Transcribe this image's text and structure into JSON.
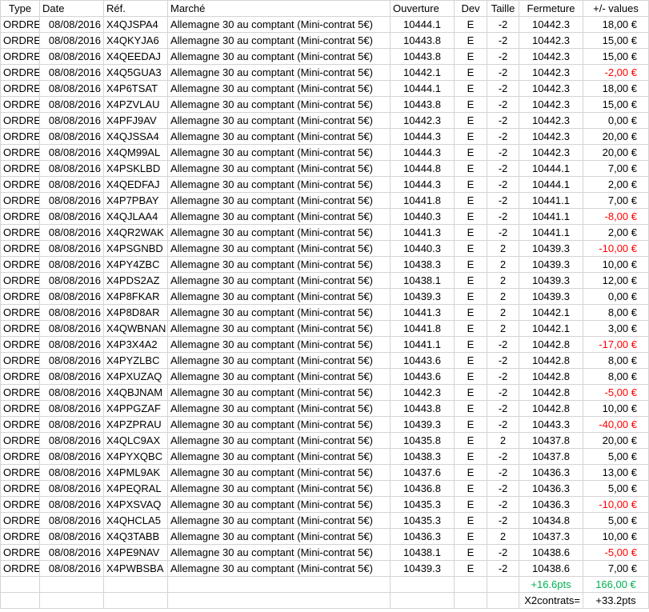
{
  "headers": {
    "type": "Type",
    "date": "Date",
    "ref": "Réf.",
    "market": "Marché",
    "open": "Ouverture",
    "dev": "Dev",
    "size": "Taille",
    "close": "Fermeture",
    "pnl": "+/- values"
  },
  "rows": [
    [
      "ORDRE",
      "08/08/2016",
      "X4QJSPA4",
      "Allemagne 30 au comptant (Mini-contrat 5€)",
      "10444.1",
      "E",
      "-2",
      "10442.3",
      "18,00 €"
    ],
    [
      "ORDRE",
      "08/08/2016",
      "X4QKYJA6",
      "Allemagne 30 au comptant (Mini-contrat 5€)",
      "10443.8",
      "E",
      "-2",
      "10442.3",
      "15,00 €"
    ],
    [
      "ORDRE",
      "08/08/2016",
      "X4QEEDAJ",
      "Allemagne 30 au comptant (Mini-contrat 5€)",
      "10443.8",
      "E",
      "-2",
      "10442.3",
      "15,00 €"
    ],
    [
      "ORDRE",
      "08/08/2016",
      "X4Q5GUA3",
      "Allemagne 30 au comptant (Mini-contrat 5€)",
      "10442.1",
      "E",
      "-2",
      "10442.3",
      "-2,00 €"
    ],
    [
      "ORDRE",
      "08/08/2016",
      "X4P6TSAT",
      "Allemagne 30 au comptant (Mini-contrat 5€)",
      "10444.1",
      "E",
      "-2",
      "10442.3",
      "18,00 €"
    ],
    [
      "ORDRE",
      "08/08/2016",
      "X4PZVLAU",
      "Allemagne 30 au comptant (Mini-contrat 5€)",
      "10443.8",
      "E",
      "-2",
      "10442.3",
      "15,00 €"
    ],
    [
      "ORDRE",
      "08/08/2016",
      "X4PFJ9AV",
      "Allemagne 30 au comptant (Mini-contrat 5€)",
      "10442.3",
      "E",
      "-2",
      "10442.3",
      "0,00 €"
    ],
    [
      "ORDRE",
      "08/08/2016",
      "X4QJSSA4",
      "Allemagne 30 au comptant (Mini-contrat 5€)",
      "10444.3",
      "E",
      "-2",
      "10442.3",
      "20,00 €"
    ],
    [
      "ORDRE",
      "08/08/2016",
      "X4QM99AL",
      "Allemagne 30 au comptant (Mini-contrat 5€)",
      "10444.3",
      "E",
      "-2",
      "10442.3",
      "20,00 €"
    ],
    [
      "ORDRE",
      "08/08/2016",
      "X4PSKLBD",
      "Allemagne 30 au comptant (Mini-contrat 5€)",
      "10444.8",
      "E",
      "-2",
      "10444.1",
      "7,00 €"
    ],
    [
      "ORDRE",
      "08/08/2016",
      "X4QEDFAJ",
      "Allemagne 30 au comptant (Mini-contrat 5€)",
      "10444.3",
      "E",
      "-2",
      "10444.1",
      "2,00 €"
    ],
    [
      "ORDRE",
      "08/08/2016",
      "X4P7PBAY",
      "Allemagne 30 au comptant (Mini-contrat 5€)",
      "10441.8",
      "E",
      "-2",
      "10441.1",
      "7,00 €"
    ],
    [
      "ORDRE",
      "08/08/2016",
      "X4QJLAA4",
      "Allemagne 30 au comptant (Mini-contrat 5€)",
      "10440.3",
      "E",
      "-2",
      "10441.1",
      "-8,00 €"
    ],
    [
      "ORDRE",
      "08/08/2016",
      "X4QR2WAK",
      "Allemagne 30 au comptant (Mini-contrat 5€)",
      "10441.3",
      "E",
      "-2",
      "10441.1",
      "2,00 €"
    ],
    [
      "ORDRE",
      "08/08/2016",
      "X4PSGNBD",
      "Allemagne 30 au comptant (Mini-contrat 5€)",
      "10440.3",
      "E",
      "2",
      "10439.3",
      "-10,00 €"
    ],
    [
      "ORDRE",
      "08/08/2016",
      "X4PY4ZBC",
      "Allemagne 30 au comptant (Mini-contrat 5€)",
      "10438.3",
      "E",
      "2",
      "10439.3",
      "10,00 €"
    ],
    [
      "ORDRE",
      "08/08/2016",
      "X4PDS2AZ",
      "Allemagne 30 au comptant (Mini-contrat 5€)",
      "10438.1",
      "E",
      "2",
      "10439.3",
      "12,00 €"
    ],
    [
      "ORDRE",
      "08/08/2016",
      "X4P8FKAR",
      "Allemagne 30 au comptant (Mini-contrat 5€)",
      "10439.3",
      "E",
      "2",
      "10439.3",
      "0,00 €"
    ],
    [
      "ORDRE",
      "08/08/2016",
      "X4P8D8AR",
      "Allemagne 30 au comptant (Mini-contrat 5€)",
      "10441.3",
      "E",
      "2",
      "10442.1",
      "8,00 €"
    ],
    [
      "ORDRE",
      "08/08/2016",
      "X4QWBNAN",
      "Allemagne 30 au comptant (Mini-contrat 5€)",
      "10441.8",
      "E",
      "2",
      "10442.1",
      "3,00 €"
    ],
    [
      "ORDRE",
      "08/08/2016",
      "X4P3X4A2",
      "Allemagne 30 au comptant (Mini-contrat 5€)",
      "10441.1",
      "E",
      "-2",
      "10442.8",
      "-17,00 €"
    ],
    [
      "ORDRE",
      "08/08/2016",
      "X4PYZLBC",
      "Allemagne 30 au comptant (Mini-contrat 5€)",
      "10443.6",
      "E",
      "-2",
      "10442.8",
      "8,00 €"
    ],
    [
      "ORDRE",
      "08/08/2016",
      "X4PXUZAQ",
      "Allemagne 30 au comptant (Mini-contrat 5€)",
      "10443.6",
      "E",
      "-2",
      "10442.8",
      "8,00 €"
    ],
    [
      "ORDRE",
      "08/08/2016",
      "X4QBJNAM",
      "Allemagne 30 au comptant (Mini-contrat 5€)",
      "10442.3",
      "E",
      "-2",
      "10442.8",
      "-5,00 €"
    ],
    [
      "ORDRE",
      "08/08/2016",
      "X4PPGZAF",
      "Allemagne 30 au comptant (Mini-contrat 5€)",
      "10443.8",
      "E",
      "-2",
      "10442.8",
      "10,00 €"
    ],
    [
      "ORDRE",
      "08/08/2016",
      "X4PZPRAU",
      "Allemagne 30 au comptant (Mini-contrat 5€)",
      "10439.3",
      "E",
      "-2",
      "10443.3",
      "-40,00 €"
    ],
    [
      "ORDRE",
      "08/08/2016",
      "X4QLC9AX",
      "Allemagne 30 au comptant (Mini-contrat 5€)",
      "10435.8",
      "E",
      "2",
      "10437.8",
      "20,00 €"
    ],
    [
      "ORDRE",
      "08/08/2016",
      "X4PYXQBC",
      "Allemagne 30 au comptant (Mini-contrat 5€)",
      "10438.3",
      "E",
      "-2",
      "10437.8",
      "5,00 €"
    ],
    [
      "ORDRE",
      "08/08/2016",
      "X4PML9AK",
      "Allemagne 30 au comptant (Mini-contrat 5€)",
      "10437.6",
      "E",
      "-2",
      "10436.3",
      "13,00 €"
    ],
    [
      "ORDRE",
      "08/08/2016",
      "X4PEQRAL",
      "Allemagne 30 au comptant (Mini-contrat 5€)",
      "10436.8",
      "E",
      "-2",
      "10436.3",
      "5,00 €"
    ],
    [
      "ORDRE",
      "08/08/2016",
      "X4PXSVAQ",
      "Allemagne 30 au comptant (Mini-contrat 5€)",
      "10435.3",
      "E",
      "-2",
      "10436.3",
      "-10,00 €"
    ],
    [
      "ORDRE",
      "08/08/2016",
      "X4QHCLA5",
      "Allemagne 30 au comptant (Mini-contrat 5€)",
      "10435.3",
      "E",
      "-2",
      "10434.8",
      "5,00 €"
    ],
    [
      "ORDRE",
      "08/08/2016",
      "X4Q3TABB",
      "Allemagne 30 au comptant (Mini-contrat 5€)",
      "10436.3",
      "E",
      "2",
      "10437.3",
      "10,00 €"
    ],
    [
      "ORDRE",
      "08/08/2016",
      "X4PE9NAV",
      "Allemagne 30 au comptant (Mini-contrat 5€)",
      "10438.1",
      "E",
      "-2",
      "10438.6",
      "-5,00 €"
    ],
    [
      "ORDRE",
      "08/08/2016",
      "X4PWBSBA",
      "Allemagne 30 au comptant (Mini-contrat 5€)",
      "10439.3",
      "E",
      "-2",
      "10438.6",
      "7,00 €"
    ]
  ],
  "totals": {
    "points": "+16.6pts",
    "amount": "166,00 €",
    "x2_label": "X2contrats=",
    "x2_value": "+33.2pts"
  },
  "colors": {
    "negative": "#ff0000",
    "total": "#00b050",
    "grid": "#d4d4d4"
  }
}
